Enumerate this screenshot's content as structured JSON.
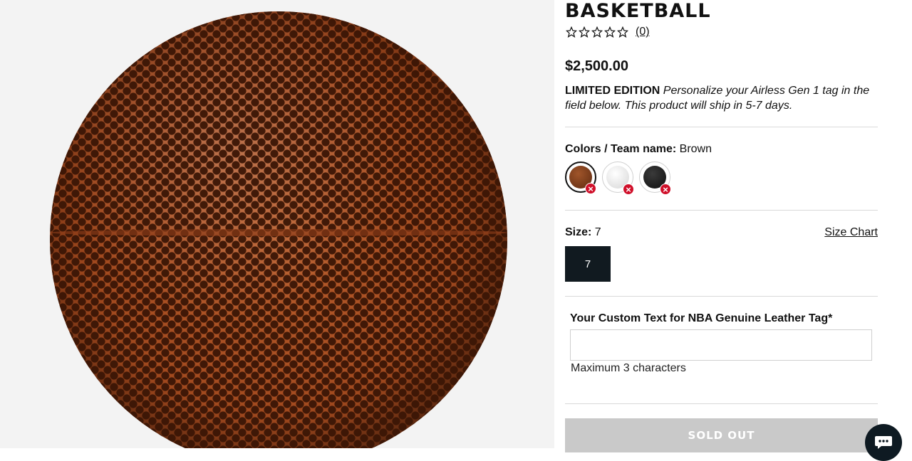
{
  "product": {
    "title": "BASKETBALL",
    "review_count": "(0)",
    "price": "$2,500.00",
    "edition_label": "LIMITED EDITION",
    "edition_text": "Personalize your Airless Gen 1 tag in the field below. This product will ship in 5-7 days."
  },
  "colors": {
    "label": "Colors / Team name:",
    "selected": "Brown",
    "options": [
      {
        "name": "Brown",
        "hex": "#7a3a1c",
        "available": false
      },
      {
        "name": "White",
        "hex": "#ececec",
        "available": false
      },
      {
        "name": "Black",
        "hex": "#1e1e1e",
        "available": false
      }
    ]
  },
  "size": {
    "label": "Size:",
    "selected": "7",
    "chart_link": "Size Chart",
    "options": [
      "7"
    ]
  },
  "custom_text": {
    "label": "Your Custom Text for NBA Genuine Leather Tag*",
    "value": "",
    "hint": "Maximum 3 characters"
  },
  "cta": {
    "label": "SOLD OUT"
  },
  "colors_theme": {
    "unavailable_badge": "#d0102a",
    "cta_disabled": "#c9c9c9",
    "size_selected": "#111a20"
  }
}
